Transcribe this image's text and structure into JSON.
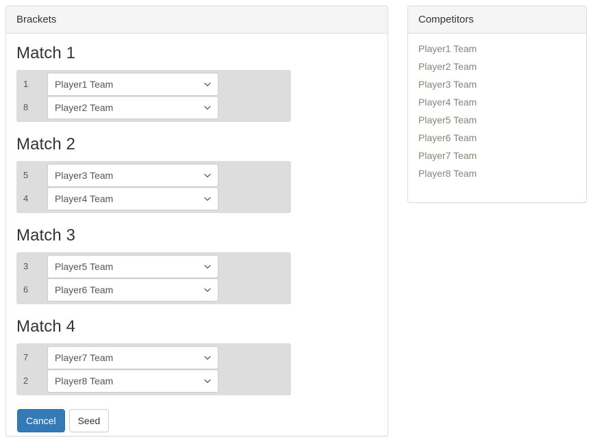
{
  "brackets_panel": {
    "title": "Brackets",
    "matches": [
      {
        "title": "Match 1",
        "slots": [
          {
            "seed": "1",
            "selected": "Player1 Team"
          },
          {
            "seed": "8",
            "selected": "Player2 Team"
          }
        ]
      },
      {
        "title": "Match 2",
        "slots": [
          {
            "seed": "5",
            "selected": "Player3 Team"
          },
          {
            "seed": "4",
            "selected": "Player4 Team"
          }
        ]
      },
      {
        "title": "Match 3",
        "slots": [
          {
            "seed": "3",
            "selected": "Player5 Team"
          },
          {
            "seed": "6",
            "selected": "Player6 Team"
          }
        ]
      },
      {
        "title": "Match 4",
        "slots": [
          {
            "seed": "7",
            "selected": "Player7 Team"
          },
          {
            "seed": "2",
            "selected": "Player8 Team"
          }
        ]
      }
    ],
    "buttons": {
      "cancel_label": "Cancel",
      "seed_label": "Seed"
    }
  },
  "competitors_panel": {
    "title": "Competitors",
    "items": [
      {
        "label": "Player1 Team"
      },
      {
        "label": "Player2 Team"
      },
      {
        "label": "Player3 Team"
      },
      {
        "label": "Player4 Team"
      },
      {
        "label": "Player5 Team"
      },
      {
        "label": "Player6 Team"
      },
      {
        "label": "Player7 Team"
      },
      {
        "label": "Player8 Team"
      }
    ]
  },
  "icons": {
    "dropdown_chevron": "chevron-down-icon"
  },
  "colors": {
    "primary_button": "#337ab7",
    "panel_border": "#dddddd",
    "panel_heading_bg": "#f5f5f5",
    "match_block_bg": "#dddddd",
    "competitor_link": "#7b8a76"
  }
}
